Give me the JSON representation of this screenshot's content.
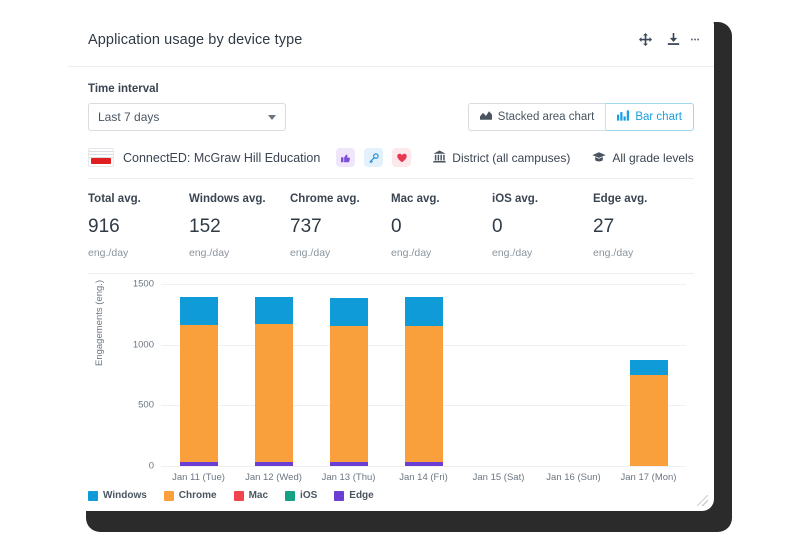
{
  "header": {
    "title": "Application usage by device type",
    "icons": [
      "move-icon",
      "download-icon",
      "more-icon"
    ]
  },
  "controls": {
    "time_interval_label": "Time interval",
    "interval_selected": "Last 7 days",
    "chart_types": [
      {
        "label": "Stacked area chart",
        "icon": "area-chart-icon",
        "active": false
      },
      {
        "label": "Bar chart",
        "icon": "bar-chart-icon",
        "active": true
      }
    ]
  },
  "application": {
    "name": "ConnectED: McGraw Hill Education",
    "badges": [
      {
        "name": "thumbs-up-icon",
        "glyph": "☝",
        "color": "#7b4fd6"
      },
      {
        "name": "key-icon",
        "glyph": "⚿",
        "color": "#2a8fd4"
      },
      {
        "name": "heart-icon",
        "glyph": "♥",
        "color": "#e8384f"
      }
    ],
    "scope": "District (all campuses)",
    "grade": "All grade levels"
  },
  "stats": [
    {
      "label": "Total avg.",
      "value": "916",
      "unit": "eng./day"
    },
    {
      "label": "Windows avg.",
      "value": "152",
      "unit": "eng./day"
    },
    {
      "label": "Chrome avg.",
      "value": "737",
      "unit": "eng./day"
    },
    {
      "label": "Mac avg.",
      "value": "0",
      "unit": "eng./day"
    },
    {
      "label": "iOS avg.",
      "value": "0",
      "unit": "eng./day"
    },
    {
      "label": "Edge avg.",
      "value": "27",
      "unit": "eng./day"
    }
  ],
  "chart_data": {
    "type": "bar",
    "stacked": true,
    "title": "Application usage by device type",
    "xlabel": "",
    "ylabel": "Engagements (eng.)",
    "ylim": [
      0,
      1500
    ],
    "yticks": [
      0,
      500,
      1000,
      1500
    ],
    "grid": true,
    "legend_position": "bottom-left",
    "categories": [
      "Jan 11 (Tue)",
      "Jan 12 (Wed)",
      "Jan 13 (Thu)",
      "Jan 14 (Fri)",
      "Jan 15 (Sat)",
      "Jan 16 (Sun)",
      "Jan 17 (Mon)"
    ],
    "series": [
      {
        "name": "Windows",
        "color": "#0f9ad8",
        "values": [
          225,
          220,
          230,
          235,
          0,
          0,
          120
        ]
      },
      {
        "name": "Chrome",
        "color": "#f9a03c",
        "values": [
          1130,
          1135,
          1120,
          1120,
          0,
          0,
          750
        ]
      },
      {
        "name": "Mac",
        "color": "#f0454f",
        "values": [
          0,
          0,
          0,
          0,
          0,
          0,
          0
        ]
      },
      {
        "name": "iOS",
        "color": "#16a085",
        "values": [
          0,
          0,
          0,
          0,
          0,
          0,
          0
        ]
      },
      {
        "name": "Edge",
        "color": "#6b3fd4",
        "values": [
          35,
          35,
          35,
          35,
          0,
          0,
          0
        ]
      }
    ]
  }
}
